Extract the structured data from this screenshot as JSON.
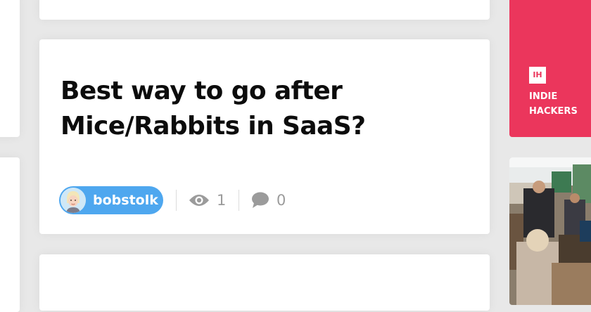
{
  "post": {
    "title": "Best way to go after Mice/Rabbits in SaaS?",
    "author": "bobstolk",
    "views": "1",
    "comments": "0"
  },
  "promo": {
    "logo_text": "IH",
    "line1": "INDIE",
    "line2": "HACKERS",
    "color": "#eb365c"
  },
  "colors": {
    "chip": "#4ea7ef",
    "stat": "#9b9b9b"
  }
}
